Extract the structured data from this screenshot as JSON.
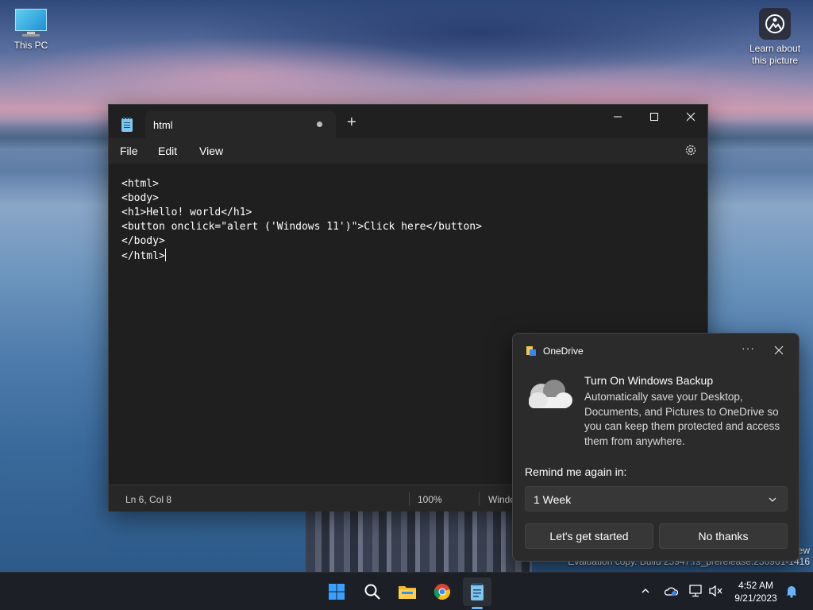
{
  "desktop": {
    "icons": [
      {
        "label": "This PC"
      },
      {
        "label": "Learn about this picture"
      }
    ],
    "watermark_top": "ew",
    "watermark": "Evaluation copy. Build 25947.rs_prerelease.230901-1416"
  },
  "notepad": {
    "tab_title": "html",
    "menu": {
      "file": "File",
      "edit": "Edit",
      "view": "View"
    },
    "content": "<html>\n<body>\n<h1>Hello! world</h1>\n<button onclick=\"alert ('Windows 11')\">Click here</button>\n</body>\n</html>",
    "status": {
      "position": "Ln 6, Col 8",
      "zoom": "100%",
      "line_ending": "Windo"
    }
  },
  "toast": {
    "app_name": "OneDrive",
    "title": "Turn On Windows Backup",
    "body": "Automatically save your Desktop, Documents, and Pictures to OneDrive so you can keep them protected and access them from anywhere.",
    "remind_label": "Remind me again in:",
    "remind_value": "1 Week",
    "primary_button": "Let's get started",
    "secondary_button": "No thanks"
  },
  "taskbar": {
    "time": "4:52 AM",
    "date": "9/21/2023"
  },
  "colors": {
    "accent": "#6ab4ff",
    "notepad_bg": "#1f1f1f",
    "toast_bg": "#2b2b2b",
    "taskbar_bg": "#1c1f26"
  },
  "icons": [
    "this-pc-icon",
    "learn-about-picture-icon",
    "notepad-icon",
    "settings-gear-icon",
    "onedrive-icon",
    "cloud-icon",
    "windows-start-icon",
    "search-icon",
    "file-explorer-icon",
    "chrome-icon",
    "notification-bell-icon"
  ]
}
